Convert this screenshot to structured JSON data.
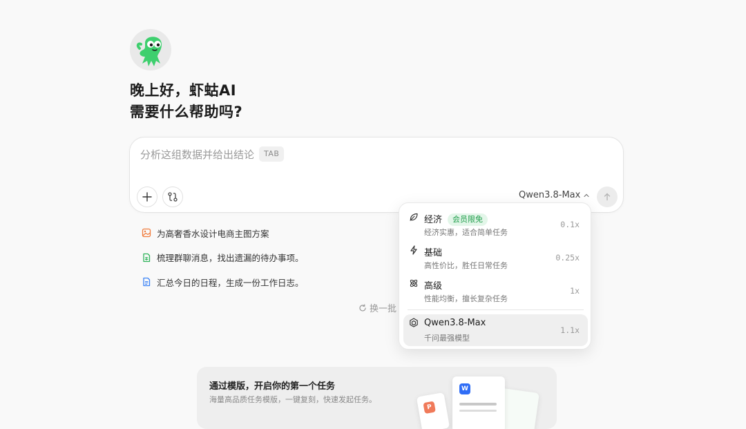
{
  "greeting": {
    "line1": "晚上好，虾蛄AI",
    "line2": "需要什么帮助吗?"
  },
  "composer": {
    "placeholder": "分析这组数据并给出结论",
    "tab_hint": "TAB",
    "model_label": "Qwen3.8-Max"
  },
  "suggestions": [
    {
      "icon": "image-icon",
      "color": "#f07a3a",
      "text": "为高奢香水设计电商主图方案"
    },
    {
      "icon": "sheet-icon",
      "color": "#2fb35a",
      "text": "梳理群聊消息，找出遗漏的待办事项。"
    },
    {
      "icon": "doc-icon",
      "color": "#3b82f6",
      "text": "汇总今日的日程，生成一份工作日志。"
    }
  ],
  "refresh_label": "换一批",
  "model_menu": {
    "options": [
      {
        "name": "经济",
        "badge": "会员限免",
        "desc": "经济实惠，适合简单任务",
        "mult": "0.1x",
        "icon": "leaf-icon",
        "selected": false
      },
      {
        "name": "基础",
        "desc": "高性价比，胜任日常任务",
        "mult": "0.25x",
        "icon": "bolt-icon",
        "selected": false
      },
      {
        "name": "高级",
        "desc": "性能均衡，擅长复杂任务",
        "mult": "1x",
        "icon": "atom-icon",
        "selected": false
      },
      {
        "name": "Qwen3.8-Max",
        "desc": "千问最强模型",
        "mult": "1.1x",
        "icon": "qwen-logo-icon",
        "selected": true
      }
    ]
  },
  "template_banner": {
    "title": "通过模版，开启你的第一个任务",
    "subtitle": "海量高品质任务模版，一键复刻，快速发起任务。",
    "word_badge": "W",
    "ppt_badge": "P"
  },
  "colors": {
    "mascot_green": "#3ecf6e",
    "badge_green": "#1f9d4a"
  }
}
